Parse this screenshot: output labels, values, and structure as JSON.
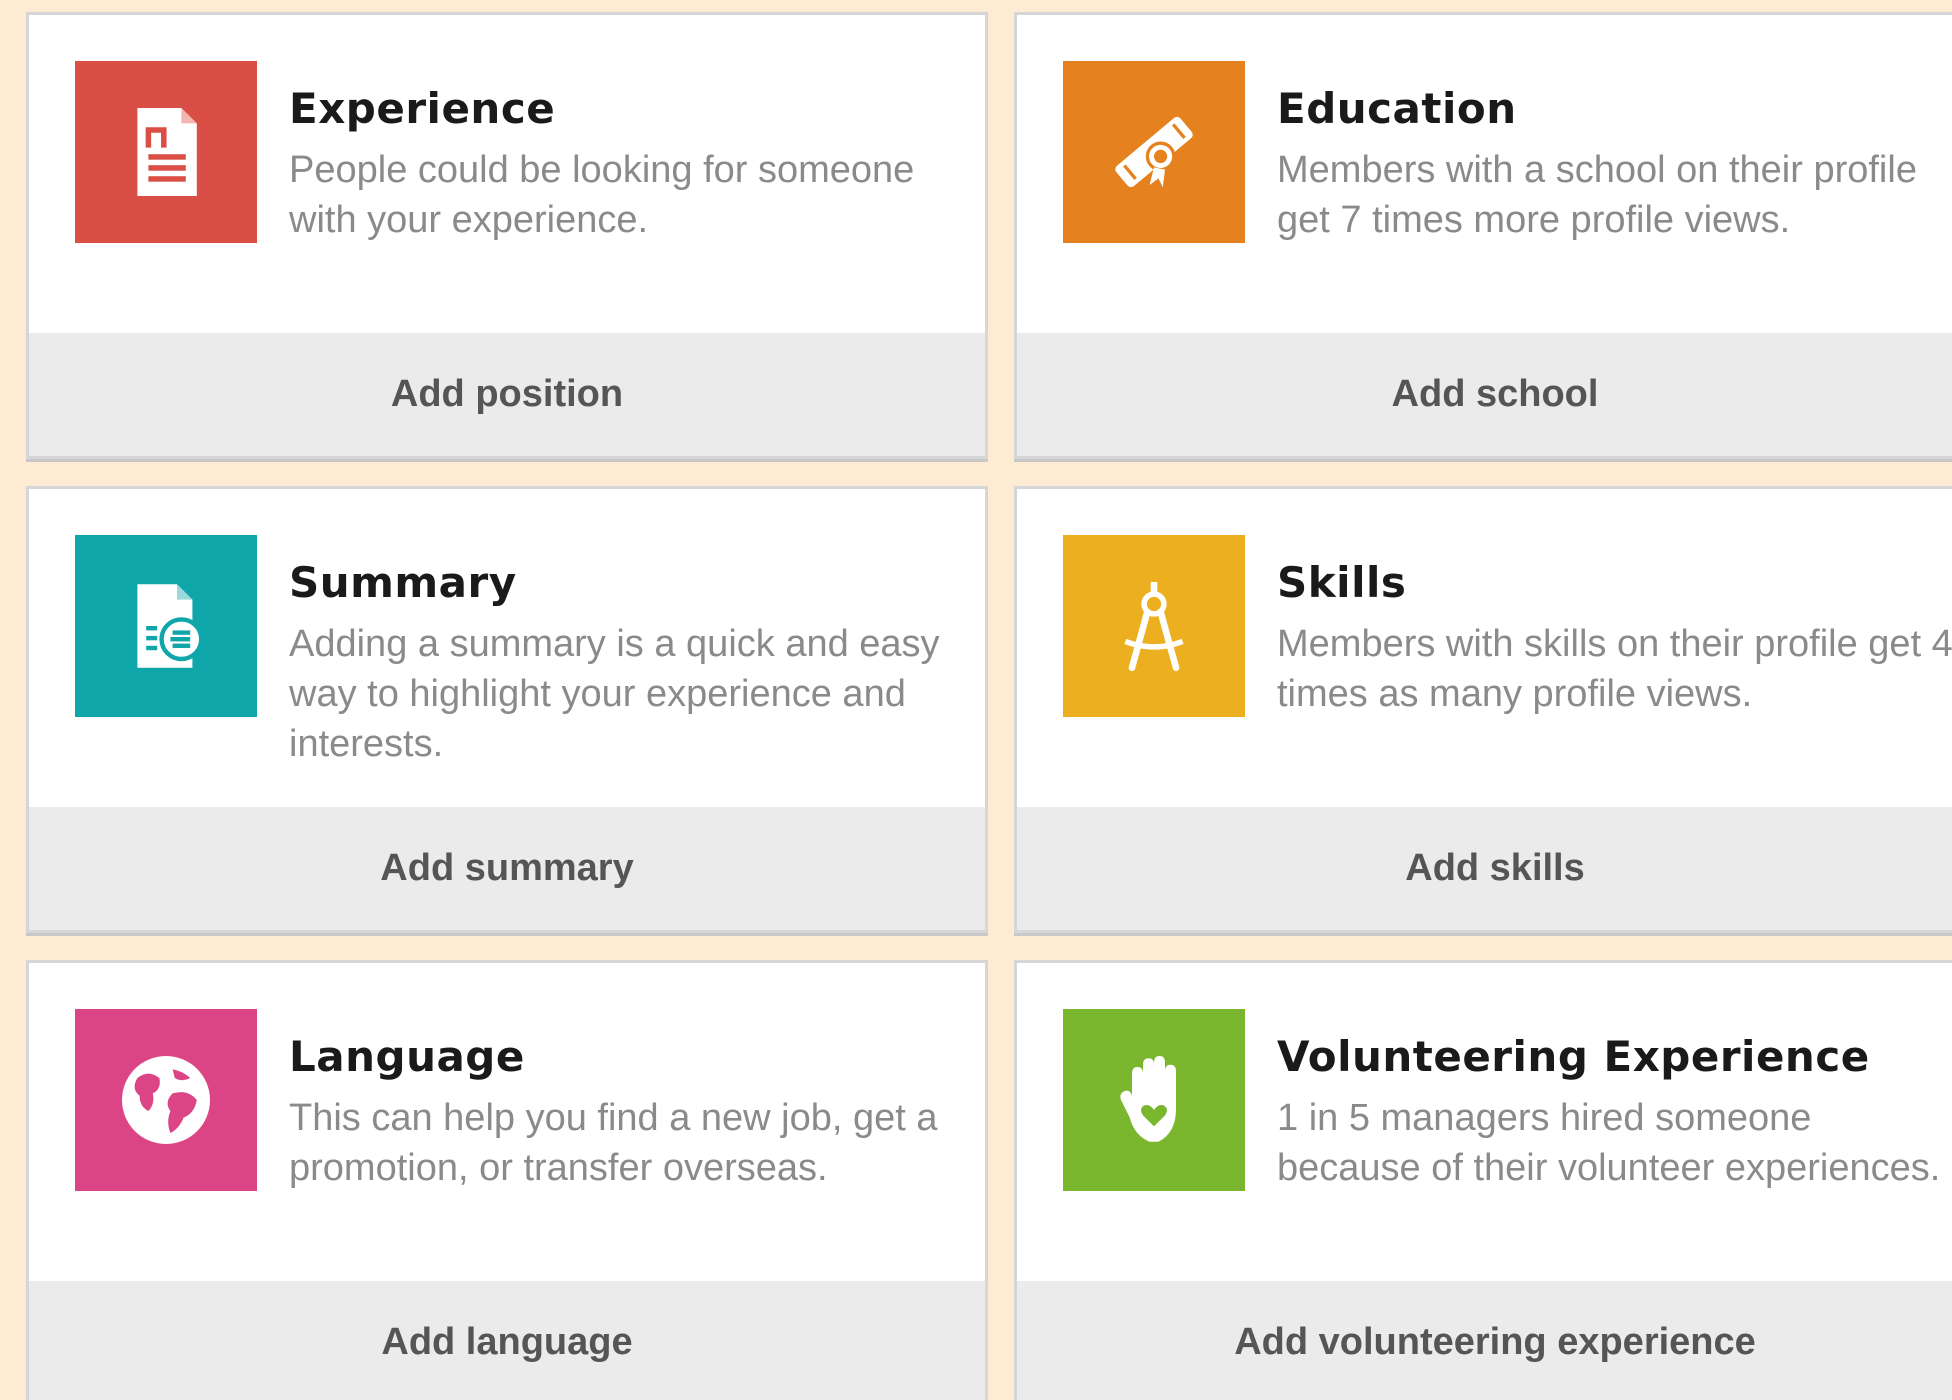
{
  "cards": [
    {
      "title": "Experience",
      "description": "People could be looking for someone with your experience.",
      "action": "Add position",
      "icon": "resume-document-icon",
      "color": "#d94f45"
    },
    {
      "title": "Education",
      "description": "Members with a school on their profile get 7 times more profile views.",
      "action": "Add school",
      "icon": "diploma-icon",
      "color": "#e5821f"
    },
    {
      "title": "Summary",
      "description": "Adding a summary is a quick and easy way to highlight your experience and interests.",
      "action": "Add summary",
      "icon": "summary-document-icon",
      "color": "#0fa6a9"
    },
    {
      "title": "Skills",
      "description": "Members with skills on their profile get 4 times as many profile views.",
      "action": "Add skills",
      "icon": "compass-icon",
      "color": "#ebaf1f"
    },
    {
      "title": "Language",
      "description": "This can help you find a new job, get a promotion, or transfer overseas.",
      "action": "Add language",
      "icon": "globe-icon",
      "color": "#db4585"
    },
    {
      "title": "Volunteering Experience",
      "description": "1 in 5 managers hired someone because of their volunteer experiences.",
      "action": "Add volunteering experience",
      "icon": "hand-heart-icon",
      "color": "#7ab72e"
    }
  ]
}
